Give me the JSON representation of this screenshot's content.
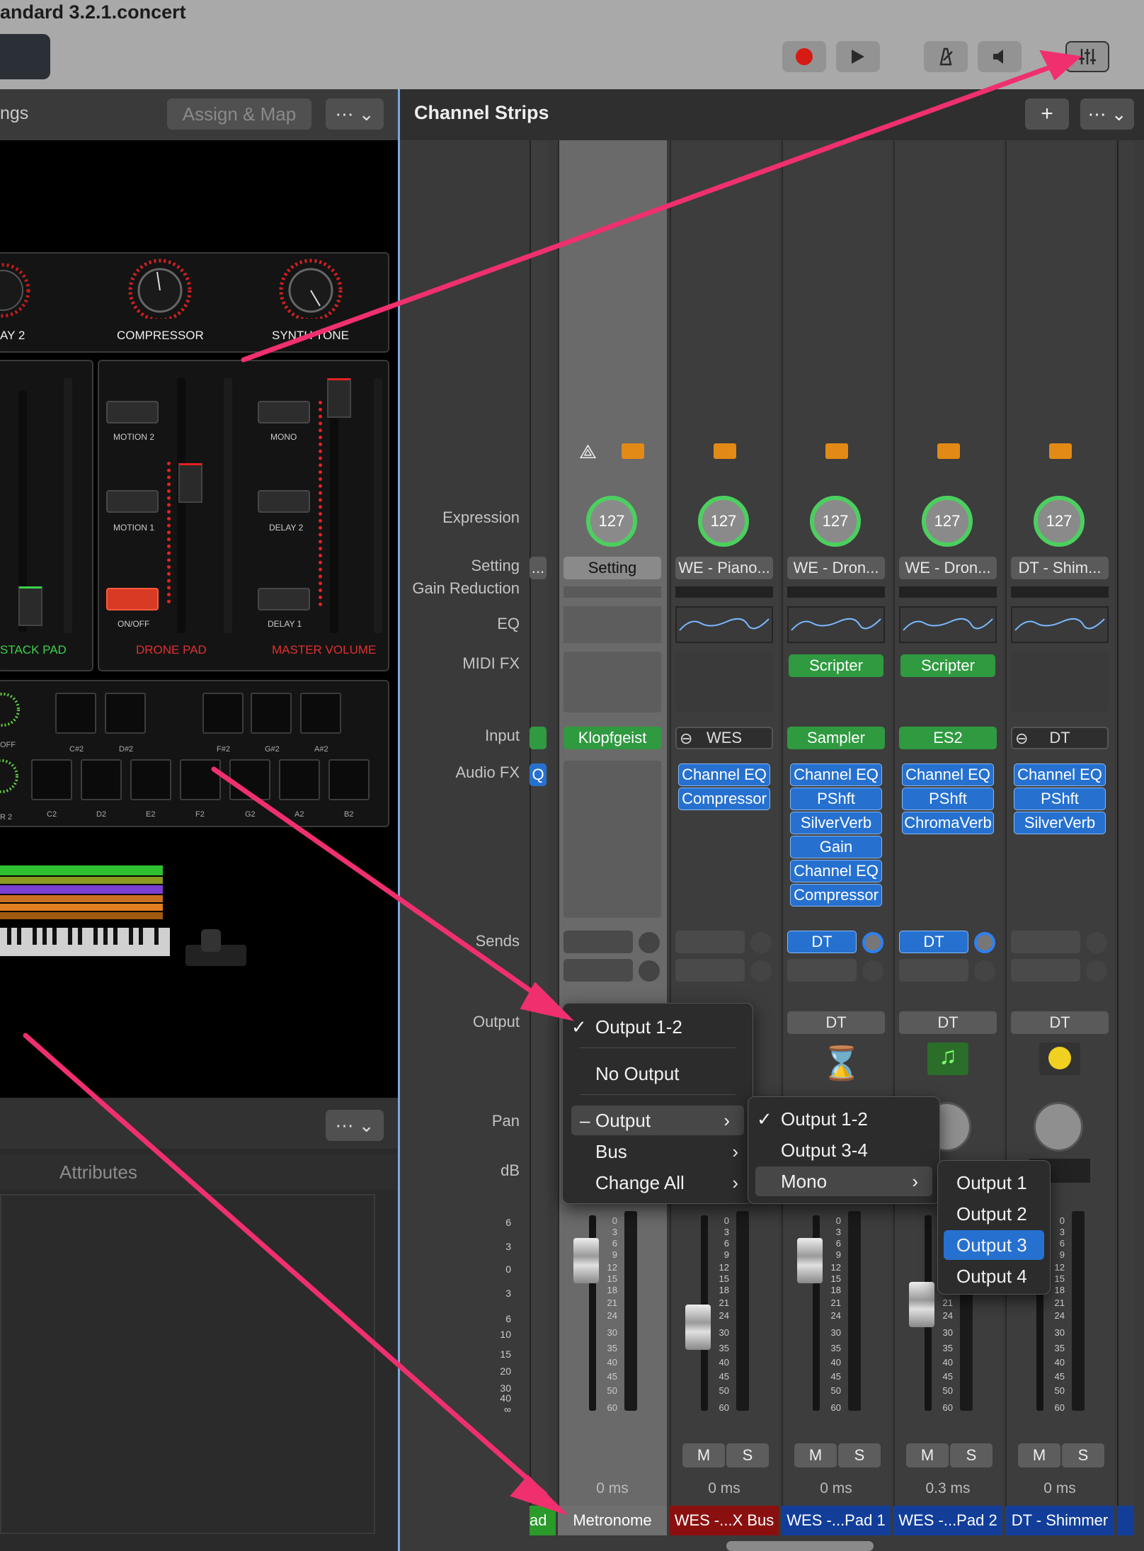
{
  "window": {
    "title": "andard 3.2.1.concert"
  },
  "toolbar": {
    "record_icon": "record-icon",
    "play_icon": "play-icon",
    "metronome_icon": "metronome-icon",
    "speaker_icon": "speaker-icon",
    "mixer_icon": "mixer-icon"
  },
  "left_panel": {
    "header_partial": "ngs",
    "assign_map": "Assign & Map",
    "knob_labels": [
      "AY 2",
      "COMPRESSOR",
      "SYNTH TONE"
    ],
    "button_labels": [
      "MOTION 2",
      "MOTION 1",
      "ON/OFF",
      "MONO",
      "DELAY 2",
      "DELAY 1"
    ],
    "section_labels": [
      "STACK PAD",
      "DRONE PAD",
      "MASTER VOLUME"
    ],
    "pad_sharp_labels": [
      "C#2",
      "D#2",
      "F#2",
      "G#2",
      "A#2"
    ],
    "pad_labels": [
      "C2",
      "D2",
      "E2",
      "F2",
      "G2",
      "A2",
      "B2"
    ],
    "partial_labels": [
      "OFF",
      "R 2"
    ],
    "attributes_tab": "Attributes"
  },
  "channel_strips": {
    "title": "Channel Strips",
    "add_button": "+",
    "row_labels": {
      "expression": "Expression",
      "setting": "Setting",
      "gain_reduction": "Gain Reduction",
      "eq": "EQ",
      "midi_fx": "MIDI FX",
      "input": "Input",
      "audio_fx": "Audio FX",
      "sends": "Sends",
      "output": "Output",
      "pan": "Pan",
      "db": "dB"
    },
    "partial_strip": {
      "setting": "...",
      "audio_fx": "Q",
      "name": "ad"
    },
    "fader_scale_left": [
      "6",
      "3",
      "0",
      "3",
      "6",
      "10",
      "15",
      "20",
      "30",
      "40",
      "∞"
    ],
    "fader_scale_strip": [
      "0",
      "3",
      "6",
      "9",
      "12",
      "15",
      "18",
      "21",
      "24",
      "30",
      "35",
      "40",
      "45",
      "50",
      "60"
    ],
    "strips": [
      {
        "expression": "127",
        "setting": "Setting",
        "input": "Klopfgeist",
        "audio_fx": [],
        "sends": [],
        "output": "",
        "latency": "0 ms",
        "name": "Metronome",
        "mute": "",
        "solo": ""
      },
      {
        "expression": "127",
        "setting": "WE - Piano...",
        "input": "WES",
        "audio_fx": [
          "Channel EQ",
          "Compressor"
        ],
        "sends": [],
        "output": "",
        "latency": "0 ms",
        "name": "WES -...X Bus",
        "mute": "M",
        "solo": "S"
      },
      {
        "expression": "127",
        "setting": "WE - Dron...",
        "midi_fx": "Scripter",
        "input": "Sampler",
        "audio_fx": [
          "Channel EQ",
          "PShft",
          "SilverVerb",
          "Gain",
          "Channel EQ",
          "Compressor"
        ],
        "sends": [
          "DT"
        ],
        "output": "DT",
        "latency": "0 ms",
        "name": "WES -...Pad 1",
        "mute": "M",
        "solo": "S"
      },
      {
        "expression": "127",
        "setting": "WE - Dron...",
        "midi_fx": "Scripter",
        "input": "ES2",
        "audio_fx": [
          "Channel EQ",
          "PShft",
          "ChromaVerb"
        ],
        "sends": [
          "DT"
        ],
        "output": "DT",
        "latency": "0.3 ms",
        "name": "WES -...Pad 2",
        "mute": "M",
        "solo": "S"
      },
      {
        "expression": "127",
        "setting": "DT - Shim...",
        "input": "DT",
        "audio_fx": [
          "Channel EQ",
          "PShft",
          "SilverVerb"
        ],
        "sends": [],
        "output": "DT",
        "latency": "0 ms",
        "name": "DT - Shimmer",
        "mute": "M",
        "solo": "S"
      }
    ]
  },
  "output_menu": {
    "items": [
      "Output 1-2",
      "No Output",
      "Output",
      "Bus",
      "Change All"
    ],
    "checked": "Output 1-2",
    "submenu_output": [
      "Output 1-2",
      "Output 3-4",
      "Mono"
    ],
    "submenu_mono": [
      "Output 1",
      "Output 2",
      "Output 3",
      "Output 4"
    ],
    "highlighted": "Output 3"
  },
  "colors": {
    "accent_blue": "#2671d0",
    "green": "#2f9a40",
    "annotation_arrow": "#f0306e",
    "red_name": "#8a1010",
    "blue_name": "#123e9a"
  }
}
